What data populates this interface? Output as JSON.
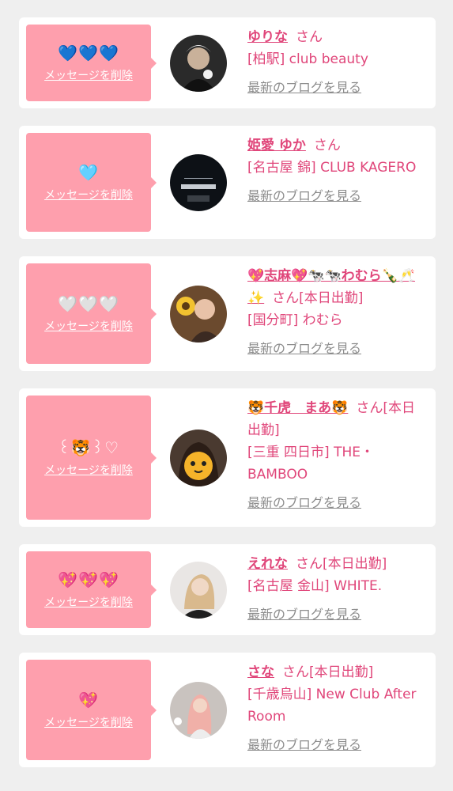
{
  "delete_label": "メッセージを削除",
  "blog_label": "最新のブログを見る",
  "colors": {
    "card_bubble": "#fe9fad",
    "name_text": "#e0467a",
    "link_gray": "#8c8c8c",
    "page_bg": "#efefef"
  },
  "cards": [
    {
      "reaction": "💙💙💙",
      "name": "ゆりな",
      "honorific": "さん",
      "shop": "[柏駅] club beauty",
      "avatar": "dark-portrait-avatar"
    },
    {
      "reaction": "🩵",
      "name": "姫愛 ゆか",
      "honorific": "さん",
      "shop": "[名古屋 錦] CLUB KAGERO",
      "avatar": "club-kagero-logo-avatar"
    },
    {
      "reaction": "🤍🤍🤍",
      "name": "💖志麻💖🐄🐄わむら🍾🥂✨",
      "honorific": "さん[本日出勤]",
      "shop": "[国分町] わむら",
      "avatar": "sunflower-portrait-avatar"
    },
    {
      "reaction": "꒰🐯꒱♡",
      "name": "🐯千虎　まあ🐯",
      "honorific": "さん[本日出勤]",
      "shop": "[三重 四日市] THE・BAMBOO",
      "avatar": "tiger-sticker-portrait-avatar"
    },
    {
      "reaction": "💖💖💖",
      "name": "えれな",
      "honorific": "さん[本日出勤]",
      "shop": "[名古屋 金山] WHITE.",
      "avatar": "blonde-portrait-avatar"
    },
    {
      "reaction": "💖",
      "name": "さな",
      "honorific": "さん[本日出勤]",
      "shop": "[千歳烏山] New Club After Room",
      "avatar": "pink-hair-selfie-avatar"
    }
  ]
}
